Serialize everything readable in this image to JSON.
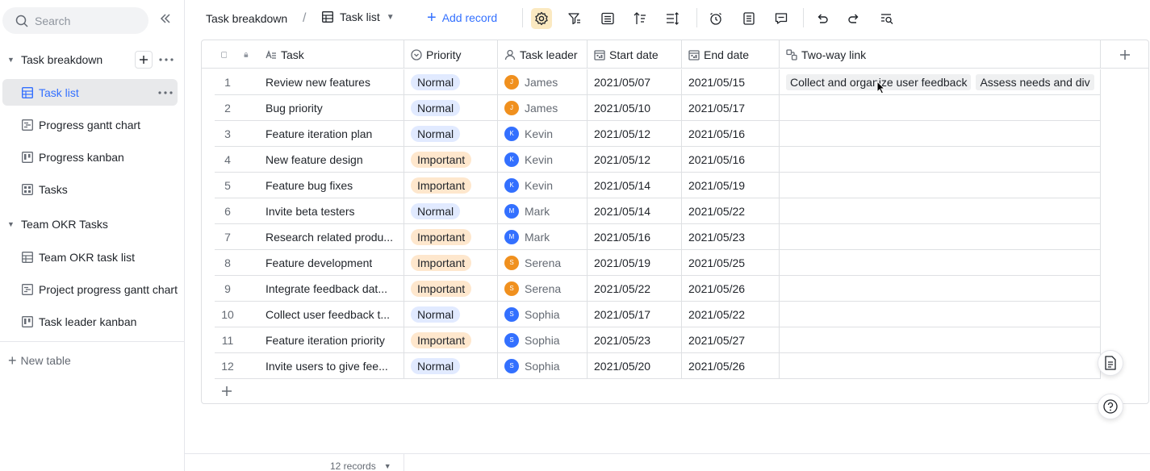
{
  "sidebar": {
    "search_placeholder": "Search",
    "groups": [
      {
        "label": "Task breakdown",
        "items": [
          {
            "label": "Task list",
            "icon": "grid-table-icon",
            "active": true
          },
          {
            "label": "Progress gantt chart",
            "icon": "gantt-icon",
            "active": false
          },
          {
            "label": "Progress kanban",
            "icon": "kanban-icon",
            "active": false
          },
          {
            "label": "Tasks",
            "icon": "gallery-icon",
            "active": false
          }
        ]
      },
      {
        "label": "Team OKR Tasks",
        "items": [
          {
            "label": "Team OKR task list",
            "icon": "grid-table-icon",
            "active": false
          },
          {
            "label": "Project progress gantt chart",
            "icon": "gantt-icon",
            "active": false
          },
          {
            "label": "Task leader kanban",
            "icon": "kanban-icon",
            "active": false
          }
        ]
      }
    ],
    "new_table_label": "New table"
  },
  "toolbar": {
    "breadcrumb": "Task breakdown",
    "separator": "/",
    "view_name": "Task list",
    "add_record_label": "Add record"
  },
  "grid": {
    "columns": [
      {
        "label": "Task",
        "icon": "text-field-icon"
      },
      {
        "label": "Priority",
        "icon": "single-select-icon"
      },
      {
        "label": "Task leader",
        "icon": "person-icon"
      },
      {
        "label": "Start date",
        "icon": "calendar-icon"
      },
      {
        "label": "End date",
        "icon": "calendar-icon"
      },
      {
        "label": "Two-way link",
        "icon": "link-icon"
      }
    ],
    "rows": [
      {
        "n": "1",
        "task": "Review new features",
        "priority": "Normal",
        "leader": "James",
        "initial": "J",
        "start": "2021/05/07",
        "end": "2021/05/15",
        "links": [
          "Collect and organize user feedback",
          "Assess needs and div"
        ]
      },
      {
        "n": "2",
        "task": "Bug priority",
        "priority": "Normal",
        "leader": "James",
        "initial": "J",
        "start": "2021/05/10",
        "end": "2021/05/17",
        "links": []
      },
      {
        "n": "3",
        "task": "Feature iteration plan",
        "priority": "Normal",
        "leader": "Kevin",
        "initial": "K",
        "start": "2021/05/12",
        "end": "2021/05/16",
        "links": []
      },
      {
        "n": "4",
        "task": "New feature design",
        "priority": "Important",
        "leader": "Kevin",
        "initial": "K",
        "start": "2021/05/12",
        "end": "2021/05/16",
        "links": []
      },
      {
        "n": "5",
        "task": "Feature bug fixes",
        "priority": "Important",
        "leader": "Kevin",
        "initial": "K",
        "start": "2021/05/14",
        "end": "2021/05/19",
        "links": []
      },
      {
        "n": "6",
        "task": "Invite beta testers",
        "priority": "Normal",
        "leader": "Mark",
        "initial": "M",
        "start": "2021/05/14",
        "end": "2021/05/22",
        "links": []
      },
      {
        "n": "7",
        "task": "Research related produ...",
        "priority": "Important",
        "leader": "Mark",
        "initial": "M",
        "start": "2021/05/16",
        "end": "2021/05/23",
        "links": []
      },
      {
        "n": "8",
        "task": "Feature development",
        "priority": "Important",
        "leader": "Serena",
        "initial": "S",
        "start": "2021/05/19",
        "end": "2021/05/25",
        "links": []
      },
      {
        "n": "9",
        "task": "Integrate feedback dat...",
        "priority": "Important",
        "leader": "Serena",
        "initial": "S",
        "start": "2021/05/22",
        "end": "2021/05/26",
        "links": []
      },
      {
        "n": "10",
        "task": "Collect user feedback t...",
        "priority": "Normal",
        "leader": "Sophia",
        "initial": "S",
        "start": "2021/05/17",
        "end": "2021/05/22",
        "links": []
      },
      {
        "n": "11",
        "task": "Feature iteration priority",
        "priority": "Important",
        "leader": "Sophia",
        "initial": "S",
        "start": "2021/05/23",
        "end": "2021/05/27",
        "links": []
      },
      {
        "n": "12",
        "task": "Invite users to give fee...",
        "priority": "Normal",
        "leader": "Sophia",
        "initial": "S",
        "start": "2021/05/20",
        "end": "2021/05/26",
        "links": []
      }
    ]
  },
  "colors": {
    "accent": "#3370ff",
    "normal_pill": "#e1eaff",
    "important_pill": "#fee7cd",
    "avatar_james": "#f0901e",
    "avatar_kevin": "#3370ff",
    "avatar_mark": "#3370ff",
    "avatar_serena": "#f0901e",
    "avatar_sophia": "#3370ff"
  },
  "footer": {
    "records_label": "12 records"
  }
}
